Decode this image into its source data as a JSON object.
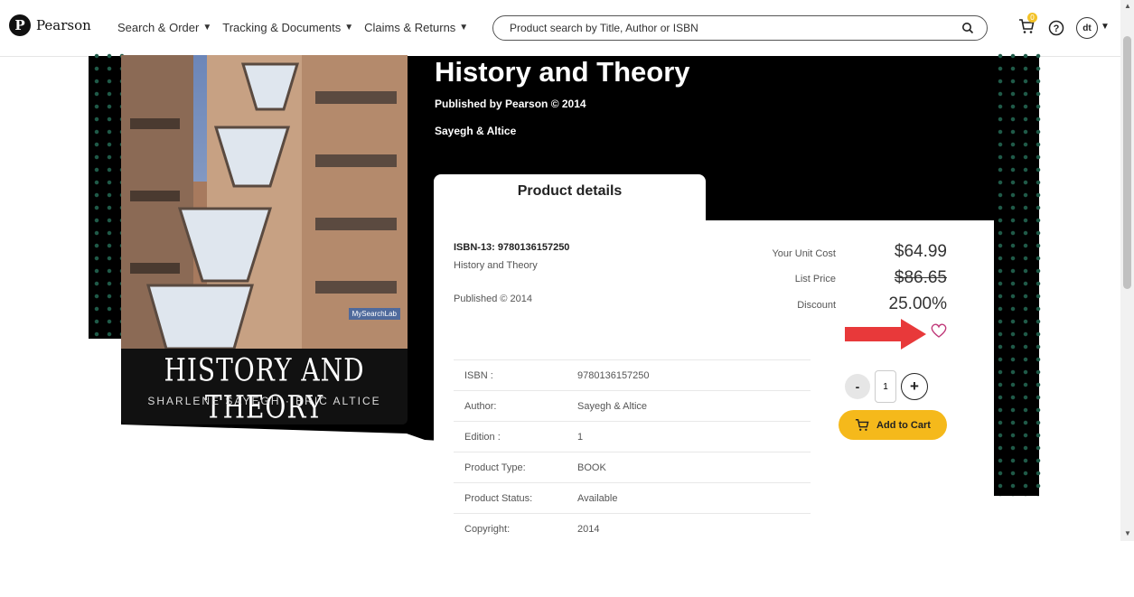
{
  "header": {
    "logo_text": "Pearson",
    "logo_mark": "P",
    "nav": [
      {
        "label": "Search & Order"
      },
      {
        "label": "Tracking & Documents"
      },
      {
        "label": "Claims & Returns"
      }
    ],
    "search_placeholder": "Product search by Title, Author or ISBN",
    "cart_count": "0",
    "avatar_initials": "dt",
    "icons": {
      "search": "search-icon",
      "cart": "cart-icon",
      "help": "help-icon",
      "chevron": "chevron-down-icon"
    }
  },
  "cover": {
    "badge": "MySearchLab",
    "title": "HISTORY AND THEORY",
    "authors": "SHARLENE SAYEGH · ERIC ALTICE"
  },
  "product": {
    "title": "History and Theory",
    "published_by": "Published by Pearson © 2014",
    "authors": "Sayegh & Altice",
    "tab_label": "Product details",
    "isbn13_line": "ISBN-13: 9780136157250",
    "subtitle": "History and Theory",
    "published": "Published © 2014"
  },
  "pricing": {
    "unit_cost_label": "Your Unit Cost",
    "unit_cost": "$64.99",
    "list_price_label": "List Price",
    "list_price": "$86.65",
    "discount_label": "Discount",
    "discount": "25.00%"
  },
  "details": [
    {
      "key": "ISBN :",
      "value": "9780136157250"
    },
    {
      "key": "Author:",
      "value": "Sayegh & Altice"
    },
    {
      "key": "Edition :",
      "value": "1"
    },
    {
      "key": "Product Type:",
      "value": "BOOK"
    },
    {
      "key": "Product Status:",
      "value": "Available"
    },
    {
      "key": "Copyright:",
      "value": "2014"
    }
  ],
  "cart": {
    "minus": "-",
    "plus": "+",
    "quantity": "1",
    "add_label": "Add to Cart"
  },
  "colors": {
    "accent": "#f5b91b",
    "heart": "#c03a7a",
    "arrow": "#e8393a",
    "hero": "#000000"
  }
}
